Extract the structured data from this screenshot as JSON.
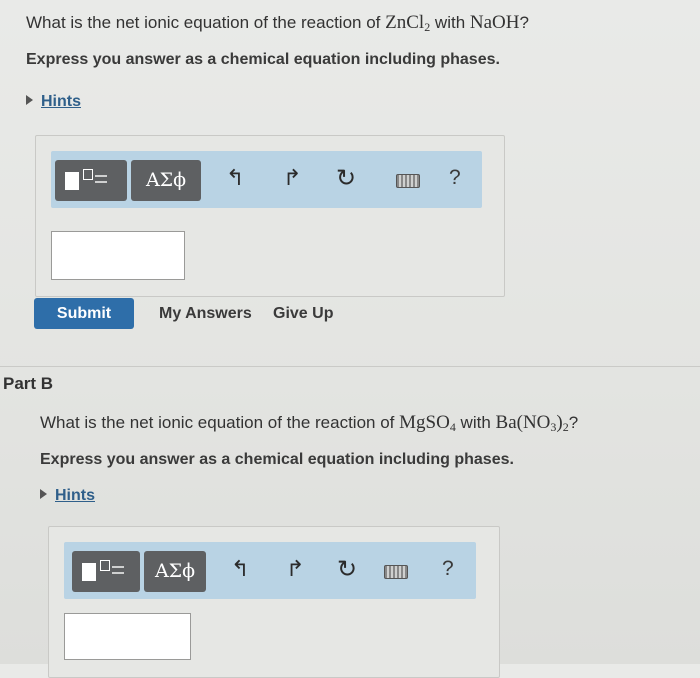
{
  "partA": {
    "question_prefix": "What is the net ionic equation of the reaction of",
    "reactant1_base": "ZnCl",
    "reactant1_sub": "2",
    "joiner": "with",
    "reactant2": "NaOH",
    "question_end": "?",
    "instruction": "Express you answer as a chemical equation including phases.",
    "hints_label": "Hints",
    "toolbar": {
      "greek_label": "ΑΣϕ",
      "help_label": "?"
    },
    "answer_value": "",
    "submit_label": "Submit",
    "my_answers_label": "My Answers",
    "give_up_label": "Give Up"
  },
  "partB": {
    "heading": "Part B",
    "question_prefix": "What is the net ionic equation of the reaction of",
    "reactant1_base": "MgSO",
    "reactant1_sub": "4",
    "joiner": "with",
    "reactant2_base": "Ba(NO",
    "reactant2_sub1": "3",
    "reactant2_close": ")",
    "reactant2_sub2": "2",
    "question_end": "?",
    "instruction": "Express you answer as a chemical equation including phases.",
    "hints_label": "Hints",
    "toolbar": {
      "greek_label": "ΑΣϕ",
      "help_label": "?"
    },
    "answer_value": ""
  },
  "colors": {
    "toolbar_bg": "#b9d3e4",
    "button_dark": "#5e6062",
    "submit_bg": "#2e6ea9",
    "hint_link": "#2f5f8a"
  },
  "icons": [
    "template-icon",
    "undo-icon",
    "redo-icon",
    "reset-icon",
    "keyboard-icon",
    "help-icon"
  ]
}
